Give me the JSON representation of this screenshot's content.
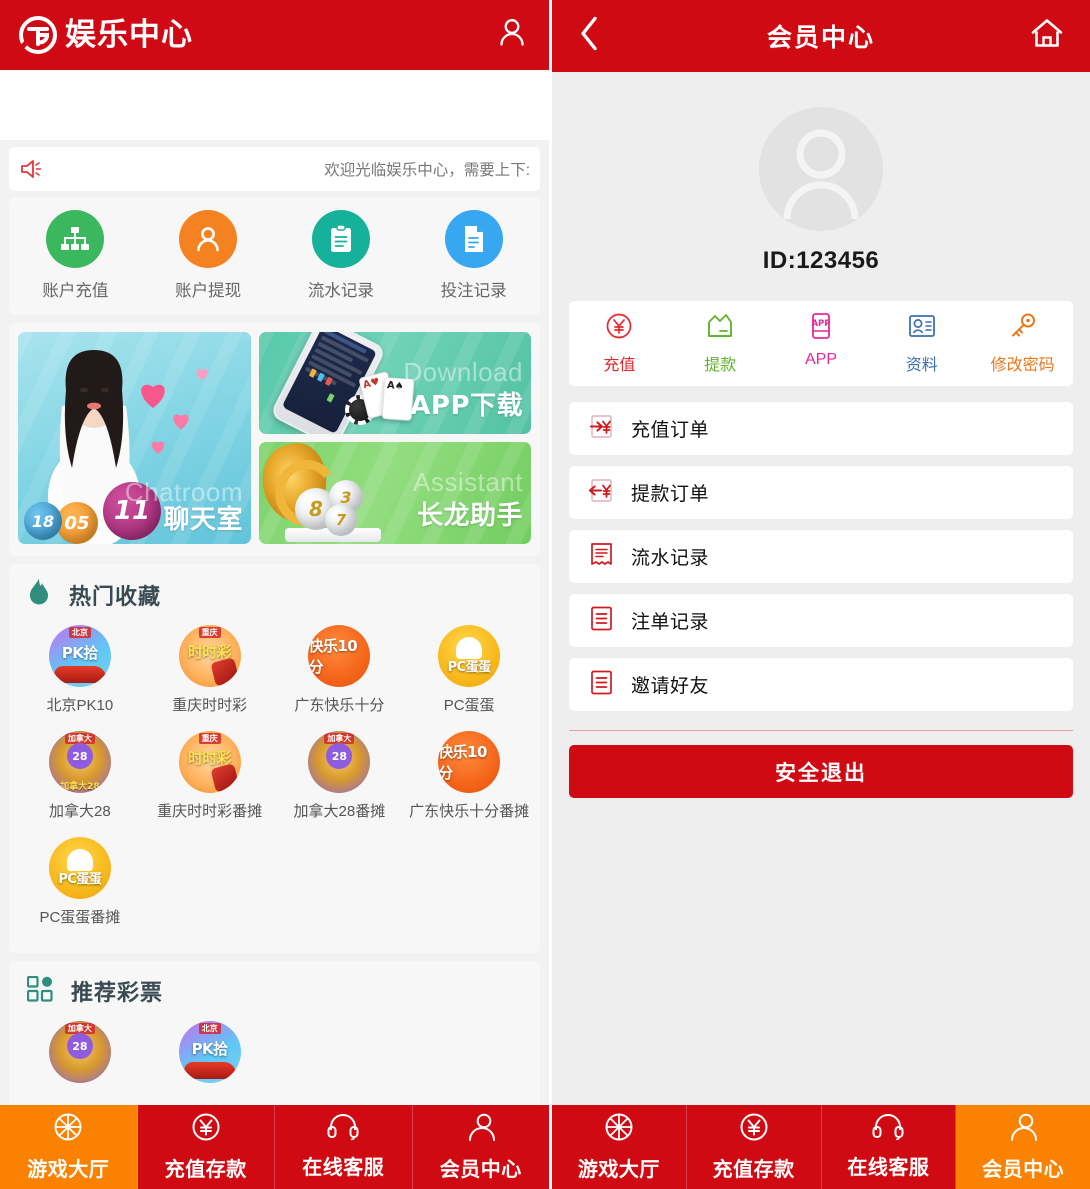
{
  "left": {
    "header": {
      "logo_text": "娱乐中心",
      "user_icon": "user-icon"
    },
    "notice": {
      "icon": "megaphone-icon",
      "text": "欢迎光临娱乐中心，需要上下:"
    },
    "quick_entries": [
      {
        "label": "账户充值",
        "icon": "sitemap-icon",
        "color": "#3bb75e"
      },
      {
        "label": "账户提现",
        "icon": "user-icon",
        "color": "#f58220"
      },
      {
        "label": "流水记录",
        "icon": "clipboard-icon",
        "color": "#16b19b"
      },
      {
        "label": "投注记录",
        "icon": "document-icon",
        "color": "#36a7f0"
      }
    ],
    "banners": [
      {
        "name": "chatroom",
        "ghost": "Chatroom",
        "title": "聊天室"
      },
      {
        "name": "app-download",
        "ghost": "Download",
        "title": "APP下载"
      },
      {
        "name": "assistant",
        "ghost": "Assistant",
        "title": "长龙助手"
      }
    ],
    "sections": [
      {
        "id": "hot",
        "icon": "flame-icon",
        "title": "热门收藏",
        "games": [
          {
            "label": "北京PK10",
            "art": "pk10",
            "cap": "北京",
            "main": "PK拾"
          },
          {
            "label": "重庆时时彩",
            "art": "ssc",
            "cap": "重庆",
            "main": "时时彩"
          },
          {
            "label": "广东快乐十分",
            "art": "kl10",
            "cap": "",
            "main": "快乐10分"
          },
          {
            "label": "PC蛋蛋",
            "art": "pc",
            "cap": "",
            "main": "PC蛋蛋"
          },
          {
            "label": "加拿大28",
            "art": "ca28",
            "cap": "加拿大",
            "main": "28"
          },
          {
            "label": "重庆时时彩番摊",
            "art": "ssc",
            "cap": "重庆",
            "main": "时时彩"
          },
          {
            "label": "加拿大28番摊",
            "art": "ca28",
            "cap": "加拿大",
            "main": "28"
          },
          {
            "label": "广东快乐十分番摊",
            "art": "kl10",
            "cap": "",
            "main": "快乐10分"
          },
          {
            "label": "PC蛋蛋番摊",
            "art": "pc",
            "cap": "",
            "main": "PC蛋蛋"
          }
        ]
      },
      {
        "id": "recommend",
        "icon": "grid-icon",
        "title": "推荐彩票",
        "games": [
          {
            "label": "",
            "art": "ca28",
            "cap": "加拿大",
            "main": "28"
          },
          {
            "label": "",
            "art": "pk10",
            "cap": "北京",
            "main": "PK拾"
          }
        ]
      }
    ],
    "tabbar": [
      {
        "label": "游戏大厅",
        "icon": "wheel-icon",
        "active": true
      },
      {
        "label": "充值存款",
        "icon": "yen-icon",
        "active": false
      },
      {
        "label": "在线客服",
        "icon": "headset-icon",
        "active": false
      },
      {
        "label": "会员中心",
        "icon": "member-icon",
        "active": false
      }
    ]
  },
  "right": {
    "header": {
      "title": "会员中心",
      "back_icon": "chevron-left-icon",
      "home_icon": "home-icon"
    },
    "profile": {
      "avatar_icon": "avatar-placeholder-icon",
      "user_id": "ID:123456"
    },
    "quick_entries": [
      {
        "label": "充值",
        "icon": "yen-circle-icon",
        "color": "#e8262c"
      },
      {
        "label": "提款",
        "icon": "withdraw-tray-icon",
        "color": "#63b32e"
      },
      {
        "label": "APP",
        "icon": "app-icon",
        "color": "#e6299a"
      },
      {
        "label": "资料",
        "icon": "id-card-icon",
        "color": "#3d6fb5"
      },
      {
        "label": "修改密码",
        "icon": "key-icon",
        "color": "#e8791b"
      }
    ],
    "menu": [
      {
        "label": "充值订单",
        "icon": "deposit-order-icon"
      },
      {
        "label": "提款订单",
        "icon": "withdraw-order-icon"
      },
      {
        "label": "流水记录",
        "icon": "receipt-icon"
      },
      {
        "label": "注单记录",
        "icon": "bet-record-icon"
      },
      {
        "label": "邀请好友",
        "icon": "invite-friend-icon"
      }
    ],
    "logout_label": "安全退出",
    "tabbar": [
      {
        "label": "游戏大厅",
        "icon": "wheel-icon",
        "active": false
      },
      {
        "label": "充值存款",
        "icon": "yen-icon",
        "active": false
      },
      {
        "label": "在线客服",
        "icon": "headset-icon",
        "active": false
      },
      {
        "label": "会员中心",
        "icon": "member-icon",
        "active": true
      }
    ]
  },
  "theme": {
    "brand_red": "#cf0a13",
    "header_red": "#d00a14",
    "active_orange": "#fb8100",
    "teal": "#2f8e7e"
  }
}
